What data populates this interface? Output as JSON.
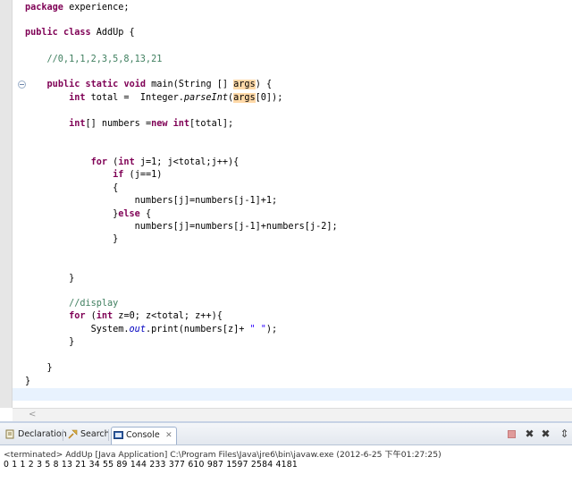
{
  "editor": {
    "code_lines": [
      [
        {
          "t": "package",
          "c": "kw"
        },
        {
          "t": " experience;"
        }
      ],
      [
        {
          "t": "public",
          "c": "kw"
        },
        {
          "t": " "
        },
        {
          "t": "class",
          "c": "kw"
        },
        {
          "t": " AddUp {"
        }
      ],
      [
        {
          "t": "    //0,1,1,2,3,5,8,13,21",
          "c": "cm"
        }
      ],
      [
        {
          "t": "    "
        },
        {
          "t": "public",
          "c": "kw"
        },
        {
          "t": " "
        },
        {
          "t": "static",
          "c": "kw"
        },
        {
          "t": " "
        },
        {
          "t": "void",
          "c": "kw"
        },
        {
          "t": " main(String [] "
        },
        {
          "t": "args",
          "c": "hl"
        },
        {
          "t": ") {"
        }
      ],
      [
        {
          "t": "        "
        },
        {
          "t": "int",
          "c": "kw"
        },
        {
          "t": " total =  Integer."
        },
        {
          "t": "parseInt",
          "c": "it"
        },
        {
          "t": "("
        },
        {
          "t": "args",
          "c": "hl"
        },
        {
          "t": "[0]);"
        }
      ],
      [
        {
          "t": "        "
        },
        {
          "t": "int",
          "c": "kw"
        },
        {
          "t": "[] numbers ="
        },
        {
          "t": "new",
          "c": "kw"
        },
        {
          "t": " "
        },
        {
          "t": "int",
          "c": "kw"
        },
        {
          "t": "[total];"
        }
      ],
      [
        {
          "t": "            "
        },
        {
          "t": "for",
          "c": "kw"
        },
        {
          "t": " ("
        },
        {
          "t": "int",
          "c": "kw"
        },
        {
          "t": " j=1; j<total;j++){"
        }
      ],
      [
        {
          "t": "                "
        },
        {
          "t": "if",
          "c": "kw"
        },
        {
          "t": " (j==1)"
        }
      ],
      [
        {
          "t": "                {"
        }
      ],
      [
        {
          "t": "                    numbers[j]=numbers[j-1]+1;"
        }
      ],
      [
        {
          "t": "                }"
        },
        {
          "t": "else",
          "c": "kw"
        },
        {
          "t": " {"
        }
      ],
      [
        {
          "t": "                    numbers[j]=numbers[j-1]+numbers[j-2];"
        }
      ],
      [
        {
          "t": "                }"
        }
      ],
      [
        {
          "t": "        }"
        }
      ],
      [
        {
          "t": "        //display",
          "c": "cm"
        }
      ],
      [
        {
          "t": "        "
        },
        {
          "t": "for",
          "c": "kw"
        },
        {
          "t": " ("
        },
        {
          "t": "int",
          "c": "kw"
        },
        {
          "t": " z=0; z<total; z++){"
        }
      ],
      [
        {
          "t": "            System."
        },
        {
          "t": "out",
          "c": "fld"
        },
        {
          "t": ".print(numbers[z]+ "
        },
        {
          "t": "\" \"",
          "c": "st"
        },
        {
          "t": ");"
        }
      ],
      [
        {
          "t": "        }"
        }
      ],
      [
        {
          "t": "    }"
        }
      ],
      [
        {
          "t": "}"
        }
      ]
    ],
    "scroll_arrow": "<"
  },
  "panel": {
    "tabs": [
      {
        "label": "Declaration",
        "icon": "declaration-icon"
      },
      {
        "label": "Search",
        "icon": "search-icon"
      },
      {
        "label": "Console",
        "icon": "console-icon",
        "active": true
      }
    ],
    "tab_close_glyph": "✕",
    "toolbar": [
      {
        "name": "terminate",
        "icon": "terminate-icon"
      },
      {
        "name": "remove-launch",
        "icon": "remove-launch-icon",
        "glyph": "✖"
      },
      {
        "name": "remove-all-terminated",
        "icon": "remove-all-icon",
        "glyph": "✖"
      },
      {
        "name": "scroll-lock",
        "icon": "scroll-lock-icon",
        "glyph": "⇕"
      }
    ],
    "console_status": "<terminated> AddUp [Java Application] C:\\Program Files\\Java\\jre6\\bin\\javaw.exe (2012-6-25 下午01:27:25)",
    "console_output": "0 1 1 2 3 5 8 13 21 34 55 89 144 233 377 610 987 1597 2584 4181"
  },
  "colors": {
    "keyword": "#7f0055",
    "comment": "#3f7f5f",
    "string": "#2a00ff",
    "static_field": "#0000c0",
    "occurrence_highlight": "#ffd9a8",
    "current_line": "#e8f2fe"
  }
}
